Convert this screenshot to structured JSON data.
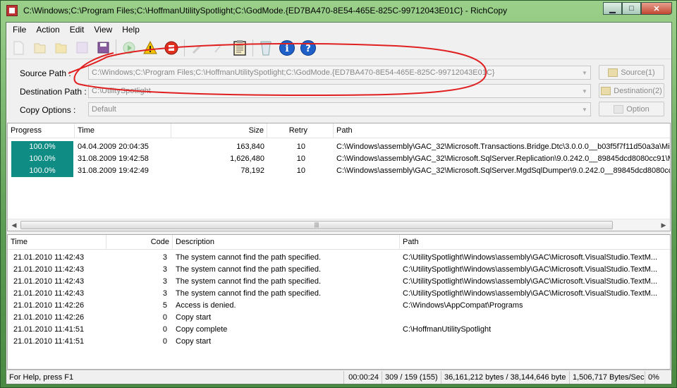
{
  "window": {
    "title": "C:\\Windows;C:\\Program Files;C:\\HoffmanUtilitySpotlight;C:\\GodMode.{ED7BA470-8E54-465E-825C-99712043E01C} - RichCopy"
  },
  "menu": [
    "File",
    "Action",
    "Edit",
    "View",
    "Help"
  ],
  "form": {
    "source_label": "Source Path :",
    "source_value": "C:\\Windows;C:\\Program Files;C:\\HoffmanUtilitySpotlight;C:\\GodMode.{ED7BA470-8E54-465E-825C-99712043E01C}",
    "source_button": "Source(1)",
    "dest_label": "Destination Path :",
    "dest_value": "C:\\UtilitySpotlight",
    "dest_button": "Destination(2)",
    "options_label": "Copy Options :",
    "options_value": "Default",
    "options_button": "Option"
  },
  "transfers": {
    "columns": [
      "Progress",
      "Time",
      "Size",
      "Retry",
      "Path"
    ],
    "rows": [
      {
        "progress": "100.0%",
        "time": "04.04.2009 20:04:35",
        "size": "163,840",
        "retry": "10",
        "path": "C:\\Windows\\assembly\\GAC_32\\Microsoft.Transactions.Bridge.Dtc\\3.0.0.0__b03f5f7f11d50a3a\\Mic"
      },
      {
        "progress": "100.0%",
        "time": "31.08.2009 19:42:58",
        "size": "1,626,480",
        "retry": "10",
        "path": "C:\\Windows\\assembly\\GAC_32\\Microsoft.SqlServer.Replication\\9.0.242.0__89845dcd8080cc91\\M"
      },
      {
        "progress": "100.0%",
        "time": "31.08.2009 19:42:49",
        "size": "78,192",
        "retry": "10",
        "path": "C:\\Windows\\assembly\\GAC_32\\Microsoft.SqlServer.MgdSqlDumper\\9.0.242.0__89845dcd8080cc9"
      }
    ]
  },
  "log": {
    "columns": [
      "Time",
      "Code",
      "Description",
      "Path"
    ],
    "rows": [
      {
        "time": "21.01.2010 11:42:43",
        "code": "3",
        "desc": "The system cannot find the path specified.",
        "path": "C:\\UtilitySpotlight\\Windows\\assembly\\GAC\\Microsoft.VisualStudio.TextM..."
      },
      {
        "time": "21.01.2010 11:42:43",
        "code": "3",
        "desc": "The system cannot find the path specified.",
        "path": "C:\\UtilitySpotlight\\Windows\\assembly\\GAC\\Microsoft.VisualStudio.TextM..."
      },
      {
        "time": "21.01.2010 11:42:43",
        "code": "3",
        "desc": "The system cannot find the path specified.",
        "path": "C:\\UtilitySpotlight\\Windows\\assembly\\GAC\\Microsoft.VisualStudio.TextM..."
      },
      {
        "time": "21.01.2010 11:42:43",
        "code": "3",
        "desc": "The system cannot find the path specified.",
        "path": "C:\\UtilitySpotlight\\Windows\\assembly\\GAC\\Microsoft.VisualStudio.TextM..."
      },
      {
        "time": "21.01.2010 11:42:26",
        "code": "5",
        "desc": "Access is denied.",
        "path": "C:\\Windows\\AppCompat\\Programs"
      },
      {
        "time": "21.01.2010 11:42:26",
        "code": "0",
        "desc": "Copy start",
        "path": ""
      },
      {
        "time": "21.01.2010 11:41:51",
        "code": "0",
        "desc": "Copy complete",
        "path": "C:\\HoffmanUtilitySpotlight"
      },
      {
        "time": "21.01.2010 11:41:51",
        "code": "0",
        "desc": "Copy start",
        "path": ""
      }
    ]
  },
  "status": {
    "help": "For Help, press F1",
    "elapsed": "00:00:24",
    "files": "309 / 159 (155)",
    "bytes": "36,161,212 bytes / 38,144,646 byte",
    "rate": "1,506,717 Bytes/Sec",
    "percent": "0%"
  },
  "colors": {
    "progress_fill": "#0f8c84",
    "annotation": "#e02020"
  }
}
